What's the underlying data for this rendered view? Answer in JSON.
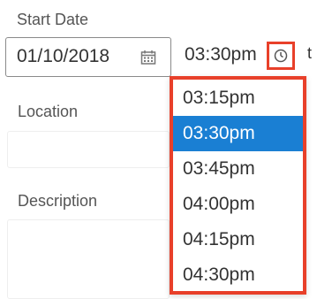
{
  "form": {
    "start_date_label": "Start Date",
    "date_value": "01/10/2018",
    "time_value": "03:30pm",
    "location_label": "Location",
    "description_label": "Description",
    "right_edge_text": "t"
  },
  "time_dropdown": {
    "options": [
      "03:15pm",
      "03:30pm",
      "03:45pm",
      "04:00pm",
      "04:15pm",
      "04:30pm"
    ],
    "selected": "03:30pm"
  },
  "colors": {
    "highlight": "#e8402a",
    "selected": "#1a7fd3"
  },
  "icons": {
    "calendar": "calendar-icon",
    "clock": "clock-icon"
  }
}
